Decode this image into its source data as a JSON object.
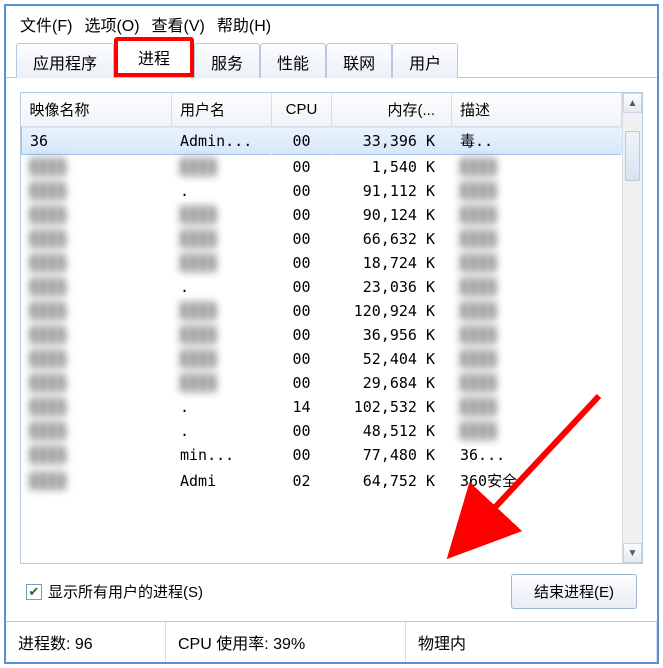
{
  "menu": {
    "file": "文件(F)",
    "options": "选项(O)",
    "view": "查看(V)",
    "help": "帮助(H)"
  },
  "tabs": {
    "apps": "应用程序",
    "processes": "进程",
    "services": "服务",
    "performance": "性能",
    "network": "联网",
    "users": "用户"
  },
  "columns": {
    "image": "映像名称",
    "user": "用户名",
    "cpu": "CPU",
    "mem": "内存(...",
    "desc": "描述"
  },
  "rows": [
    {
      "image": "36",
      "user": "Admin...",
      "cpu": "00",
      "mem": "33,396 K",
      "desc": "毒..",
      "selected": true
    },
    {
      "image": "",
      "user": "",
      "cpu": "00",
      "mem": "1,540 K",
      "desc": ""
    },
    {
      "image": "",
      "user": ".",
      "cpu": "00",
      "mem": "91,112 K",
      "desc": ""
    },
    {
      "image": "",
      "user": "",
      "cpu": "00",
      "mem": "90,124 K",
      "desc": ""
    },
    {
      "image": "",
      "user": "",
      "cpu": "00",
      "mem": "66,632 K",
      "desc": ""
    },
    {
      "image": "",
      "user": "",
      "cpu": "00",
      "mem": "18,724 K",
      "desc": ""
    },
    {
      "image": "",
      "user": ".",
      "cpu": "00",
      "mem": "23,036 K",
      "desc": ""
    },
    {
      "image": "",
      "user": "",
      "cpu": "00",
      "mem": "120,924 K",
      "desc": ""
    },
    {
      "image": "",
      "user": "",
      "cpu": "00",
      "mem": "36,956 K",
      "desc": ""
    },
    {
      "image": "",
      "user": "",
      "cpu": "00",
      "mem": "52,404 K",
      "desc": ""
    },
    {
      "image": "",
      "user": "",
      "cpu": "00",
      "mem": "29,684 K",
      "desc": ""
    },
    {
      "image": "",
      "user": ".",
      "cpu": "14",
      "mem": "102,532 K",
      "desc": ""
    },
    {
      "image": "",
      "user": ".",
      "cpu": "00",
      "mem": "48,512 K",
      "desc": ""
    },
    {
      "image": "",
      "user": "min...",
      "cpu": "00",
      "mem": "77,480 K",
      "desc": "36..."
    },
    {
      "image": "",
      "user": "Admi",
      "cpu": "02",
      "mem": "64,752 K",
      "desc": "360安全"
    }
  ],
  "bottom": {
    "show_all_label": "显示所有用户的进程(S)",
    "end_process": "结束进程(E)"
  },
  "status": {
    "procs_label": "进程数:",
    "procs_value": "96",
    "cpu_label": "CPU 使用率:",
    "cpu_value": "39%",
    "mem_label": "物理内"
  }
}
